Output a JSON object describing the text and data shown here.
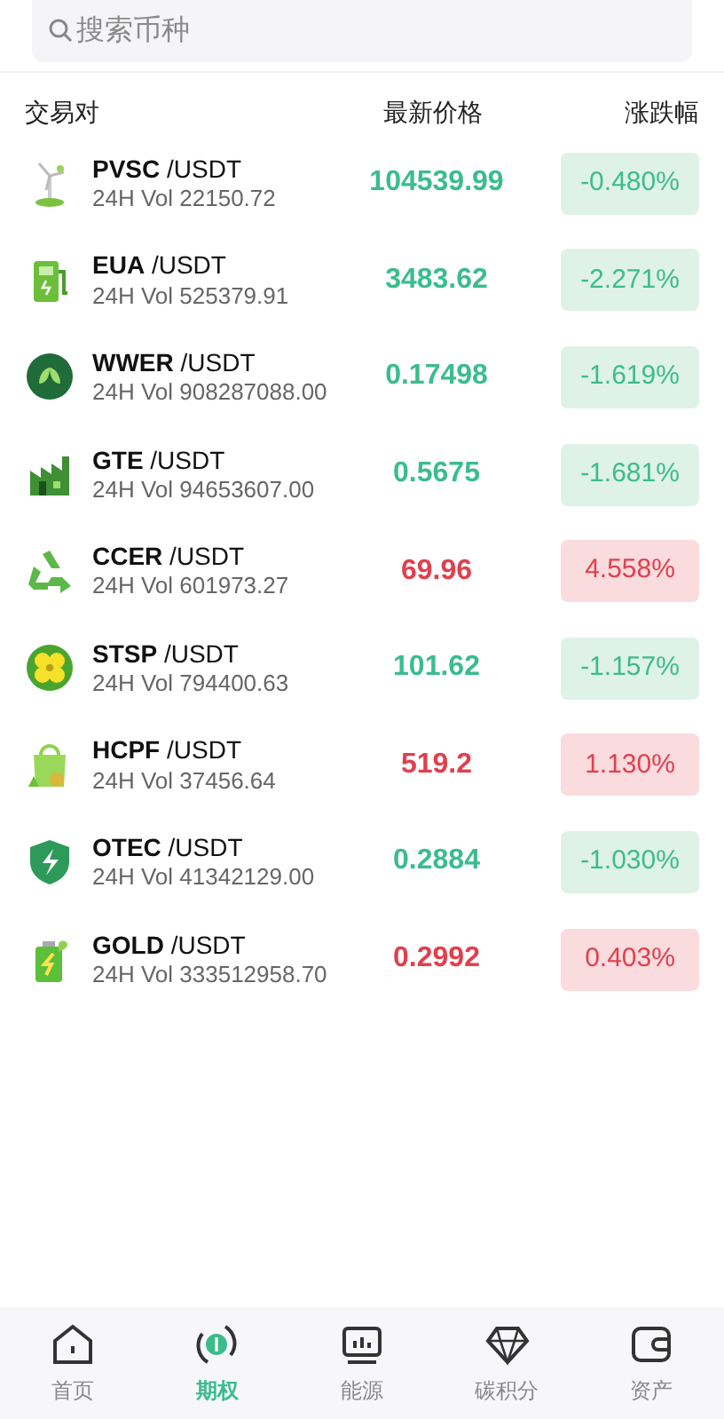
{
  "search": {
    "placeholder": "搜索币种"
  },
  "columns": [
    "交易对",
    "最新价格",
    "涨跌幅"
  ],
  "rows": [
    {
      "symbol": "PVSC",
      "quote": " /USDT",
      "volume": "24H Vol 22150.72",
      "price": "104539.99",
      "change": "-0.480%",
      "rising": false
    },
    {
      "symbol": "EUA",
      "quote": " /USDT",
      "volume": "24H Vol 525379.91",
      "price": "3483.62",
      "change": "-2.271%",
      "rising": false
    },
    {
      "symbol": "WWER",
      "quote": " /USDT",
      "volume": "24H Vol 908287088.00",
      "price": "0.17498",
      "change": "-1.619%",
      "rising": false
    },
    {
      "symbol": "GTE",
      "quote": " /USDT",
      "volume": "24H Vol 94653607.00",
      "price": "0.5675",
      "change": "-1.681%",
      "rising": false
    },
    {
      "symbol": "CCER",
      "quote": " /USDT",
      "volume": "24H Vol 601973.27",
      "price": "69.96",
      "change": "4.558%",
      "rising": true
    },
    {
      "symbol": "STSP",
      "quote": " /USDT",
      "volume": "24H Vol 794400.63",
      "price": "101.62",
      "change": "-1.157%",
      "rising": false
    },
    {
      "symbol": "HCPF",
      "quote": " /USDT",
      "volume": "24H Vol 37456.64",
      "price": "519.2",
      "change": "1.130%",
      "rising": true
    },
    {
      "symbol": "OTEC",
      "quote": " /USDT",
      "volume": "24H Vol 41342129.00",
      "price": "0.2884",
      "change": "-1.030%",
      "rising": false
    },
    {
      "symbol": "GOLD",
      "quote": " /USDT",
      "volume": "24H Vol 333512958.70",
      "price": "0.2992",
      "change": "0.403%",
      "rising": true
    }
  ],
  "tab_bar": [
    {
      "label": "首页",
      "selected": false
    },
    {
      "label": "期权",
      "selected": true
    },
    {
      "label": "能源",
      "selected": false
    },
    {
      "label": "碳积分",
      "selected": false
    },
    {
      "label": "资产",
      "selected": false
    }
  ]
}
